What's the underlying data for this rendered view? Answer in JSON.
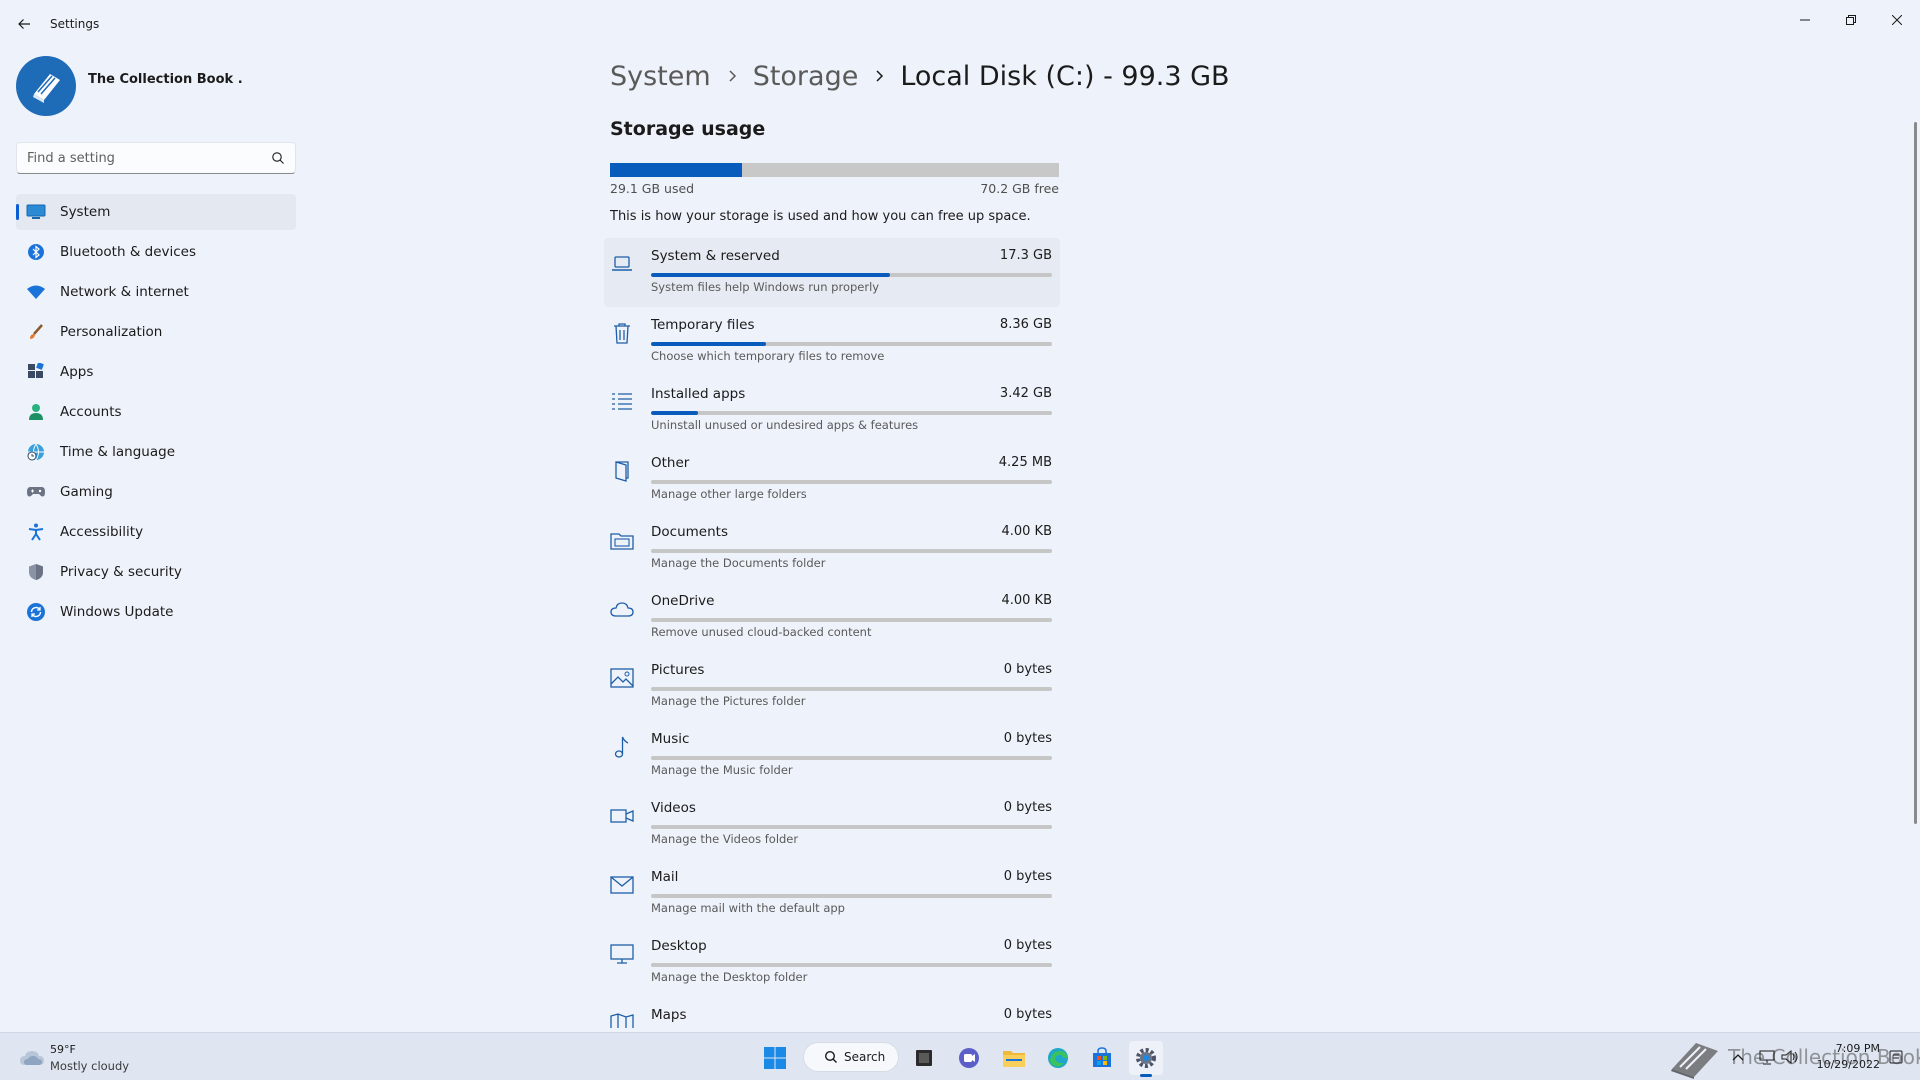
{
  "window": {
    "title": "Settings"
  },
  "profile": {
    "name": "The Collection Book ."
  },
  "search": {
    "placeholder": "Find a setting"
  },
  "nav": {
    "items": [
      {
        "label": "System",
        "icon": "monitor-icon",
        "active": true
      },
      {
        "label": "Bluetooth & devices",
        "icon": "bluetooth-icon"
      },
      {
        "label": "Network & internet",
        "icon": "wifi-icon"
      },
      {
        "label": "Personalization",
        "icon": "brush-icon"
      },
      {
        "label": "Apps",
        "icon": "apps-icon"
      },
      {
        "label": "Accounts",
        "icon": "person-icon"
      },
      {
        "label": "Time & language",
        "icon": "globe-clock-icon"
      },
      {
        "label": "Gaming",
        "icon": "gamepad-icon"
      },
      {
        "label": "Accessibility",
        "icon": "accessibility-icon"
      },
      {
        "label": "Privacy & security",
        "icon": "shield-icon"
      },
      {
        "label": "Windows Update",
        "icon": "update-icon"
      }
    ]
  },
  "breadcrumb": {
    "part1": "System",
    "part2": "Storage",
    "current": "Local Disk (C:) - 99.3 GB"
  },
  "storage": {
    "title": "Storage usage",
    "used_label": "29.1 GB used",
    "free_label": "70.2 GB free",
    "used_fraction": 0.293,
    "description": "This is how your storage is used and how you can free up space.",
    "categories": [
      {
        "name": "System & reserved",
        "size": "17.3 GB",
        "desc": "System files help Windows run properly",
        "fraction": 0.595,
        "icon": "laptop-icon"
      },
      {
        "name": "Temporary files",
        "size": "8.36 GB",
        "desc": "Choose which temporary files to remove",
        "fraction": 0.287,
        "icon": "trash-icon"
      },
      {
        "name": "Installed apps",
        "size": "3.42 GB",
        "desc": "Uninstall unused or undesired apps & features",
        "fraction": 0.118,
        "icon": "list-icon"
      },
      {
        "name": "Other",
        "size": "4.25 MB",
        "desc": "Manage other large folders",
        "fraction": 0,
        "icon": "book-icon"
      },
      {
        "name": "Documents",
        "size": "4.00 KB",
        "desc": "Manage the Documents folder",
        "fraction": 0,
        "icon": "documents-icon"
      },
      {
        "name": "OneDrive",
        "size": "4.00 KB",
        "desc": "Remove unused cloud-backed content",
        "fraction": 0,
        "icon": "cloud-icon"
      },
      {
        "name": "Pictures",
        "size": "0 bytes",
        "desc": "Manage the Pictures folder",
        "fraction": 0,
        "icon": "picture-icon"
      },
      {
        "name": "Music",
        "size": "0 bytes",
        "desc": "Manage the Music folder",
        "fraction": 0,
        "icon": "music-note-icon"
      },
      {
        "name": "Videos",
        "size": "0 bytes",
        "desc": "Manage the Videos folder",
        "fraction": 0,
        "icon": "video-icon"
      },
      {
        "name": "Mail",
        "size": "0 bytes",
        "desc": "Manage mail with the default app",
        "fraction": 0,
        "icon": "mail-icon"
      },
      {
        "name": "Desktop",
        "size": "0 bytes",
        "desc": "Manage the Desktop folder",
        "fraction": 0,
        "icon": "desktop-icon"
      },
      {
        "name": "Maps",
        "size": "0 bytes",
        "desc": "",
        "fraction": 0,
        "icon": "map-icon"
      }
    ]
  },
  "taskbar": {
    "weather_temp": "59°F",
    "weather_desc": "Mostly cloudy",
    "search_label": "Search",
    "watermark": "The Collection Book",
    "time": "7:09 PM",
    "date": "10/29/2022"
  },
  "colors": {
    "accent": "#0a5cbc",
    "bar_track": "#c8c8c8",
    "background": "#eef2fa"
  }
}
